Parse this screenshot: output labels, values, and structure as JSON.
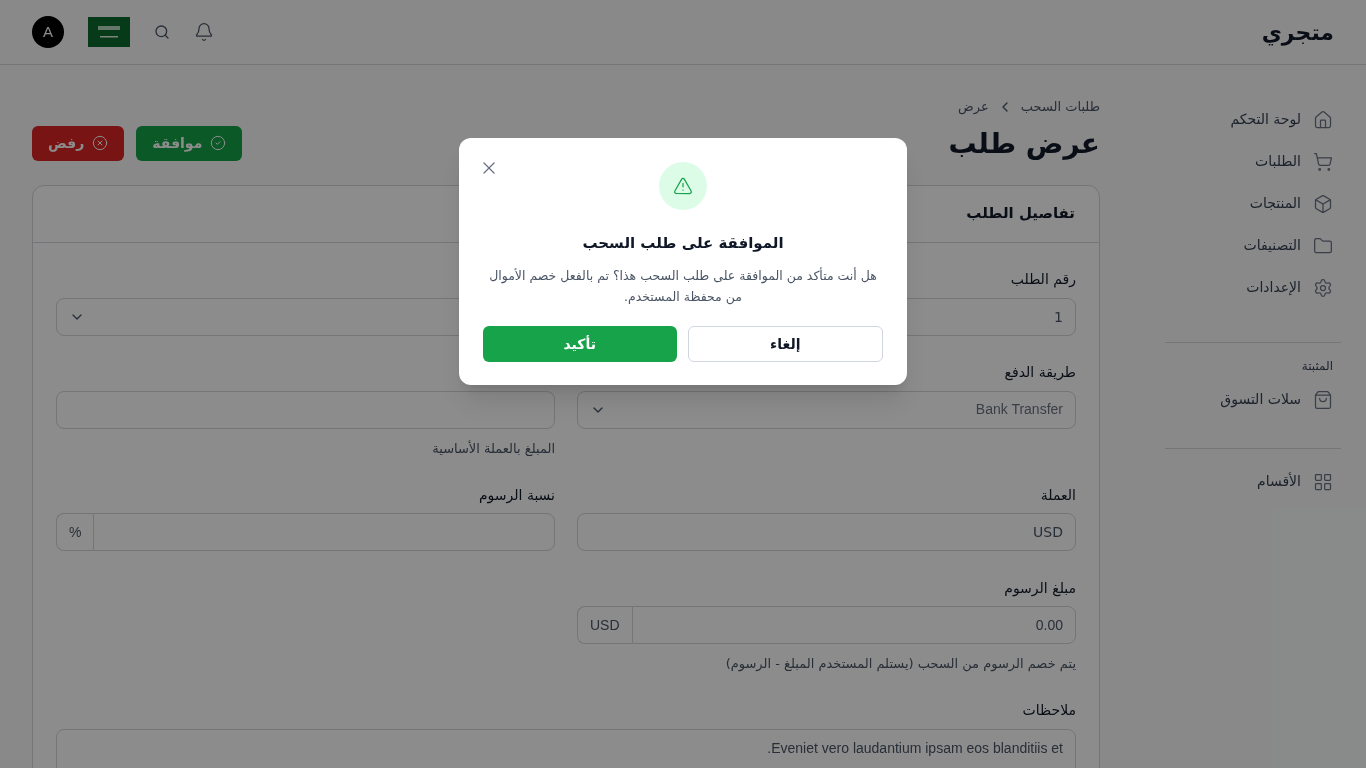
{
  "header": {
    "logo": "متجري",
    "avatar": "A"
  },
  "sidebar": {
    "items": [
      {
        "label": "لوحة التحكم",
        "selected": false
      },
      {
        "label": "الطلبات",
        "selected": false
      },
      {
        "label": "المنتجات",
        "selected": false
      },
      {
        "label": "التصنيفات",
        "selected": false
      },
      {
        "label": "الإعدادات",
        "selected": false
      }
    ],
    "pinned_heading": "المثبتة",
    "pinned": [
      {
        "label": "سلات التسوق",
        "selected": false
      }
    ],
    "extra": [
      {
        "label": "الأقسام",
        "selected": false
      }
    ]
  },
  "breadcrumb": [
    "طلبات السحب",
    "عرض"
  ],
  "title": "عرض طلب",
  "actions": [
    {
      "label": "موافقة",
      "kind": "approve"
    },
    {
      "label": "رفض",
      "kind": "reject"
    }
  ],
  "card": {
    "title": "تفاصيل الطلب",
    "fields": [
      {
        "label": "رقم الطلب",
        "kind": "input",
        "value": "1"
      },
      {
        "kind": "select"
      },
      {
        "label": "طريقة الدفع",
        "kind": "select",
        "value": "Bank Transfer"
      },
      {
        "kind": "input",
        "help": "المبلغ بالعملة الأساسية"
      },
      {
        "label": "العملة",
        "kind": "input",
        "value": "USD"
      },
      {
        "label": "نسبة الرسوم",
        "kind": "addon",
        "addon": "%"
      },
      {
        "label": "مبلغ الرسوم",
        "kind": "addon",
        "value": "0.00",
        "addon": "USD",
        "help": "يتم خصم الرسوم من السحب (يستلم المستخدم المبلغ - الرسوم)"
      },
      {
        "kind": "blank"
      },
      {
        "label": "ملاحظات",
        "kind": "textarea",
        "value": "Eveniet vero laudantium ipsam eos blanditiis et."
      }
    ]
  },
  "dialog": {
    "title": "الموافقة على طلب السحب",
    "message": "هل أنت متأكد من الموافقة على طلب السحب هذا؟ تم بالفعل خصم الأموال من محفظة المستخدم.",
    "buttons": [
      {
        "label": "إلغاء",
        "kind": "cancel"
      },
      {
        "label": "تأكيد",
        "kind": "confirm"
      }
    ]
  }
}
